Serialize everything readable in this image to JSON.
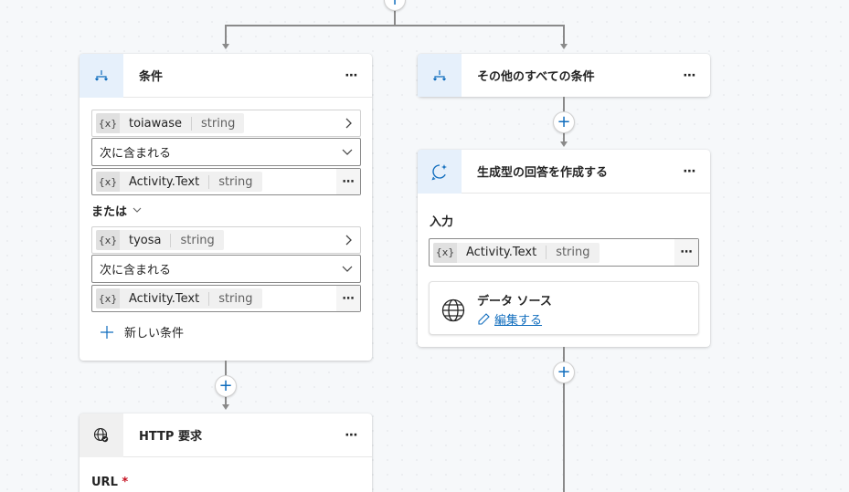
{
  "condition_card": {
    "title": "条件",
    "more": "⋯",
    "rows": [
      {
        "var_icon": "{x}",
        "name": "toiawase",
        "type": "string"
      },
      {
        "operator": "次に含まれる"
      },
      {
        "var_icon": "{x}",
        "name": "Activity.Text",
        "type": "string"
      },
      {
        "var_icon": "{x}",
        "name": "tyosa",
        "type": "string"
      },
      {
        "operator": "次に含まれる"
      },
      {
        "var_icon": "{x}",
        "name": "Activity.Text",
        "type": "string"
      }
    ],
    "or_label": "または",
    "new_condition": "新しい条件"
  },
  "else_card": {
    "title": "その他のすべての条件",
    "more": "⋯"
  },
  "generative_card": {
    "title": "生成型の回答を作成する",
    "more": "⋯",
    "input_label": "入力",
    "input": {
      "var_icon": "{x}",
      "name": "Activity.Text",
      "type": "string"
    },
    "data_source_title": "データ ソース",
    "edit_link": "編集する"
  },
  "http_card": {
    "title": "HTTP 要求",
    "more": "⋯",
    "url_label": "URL",
    "required_mark": "*"
  },
  "plus": "+",
  "colors": {
    "accent": "#0f6cbd",
    "icon_bg": "#e6f0fb",
    "line": "#8a8a8a"
  }
}
